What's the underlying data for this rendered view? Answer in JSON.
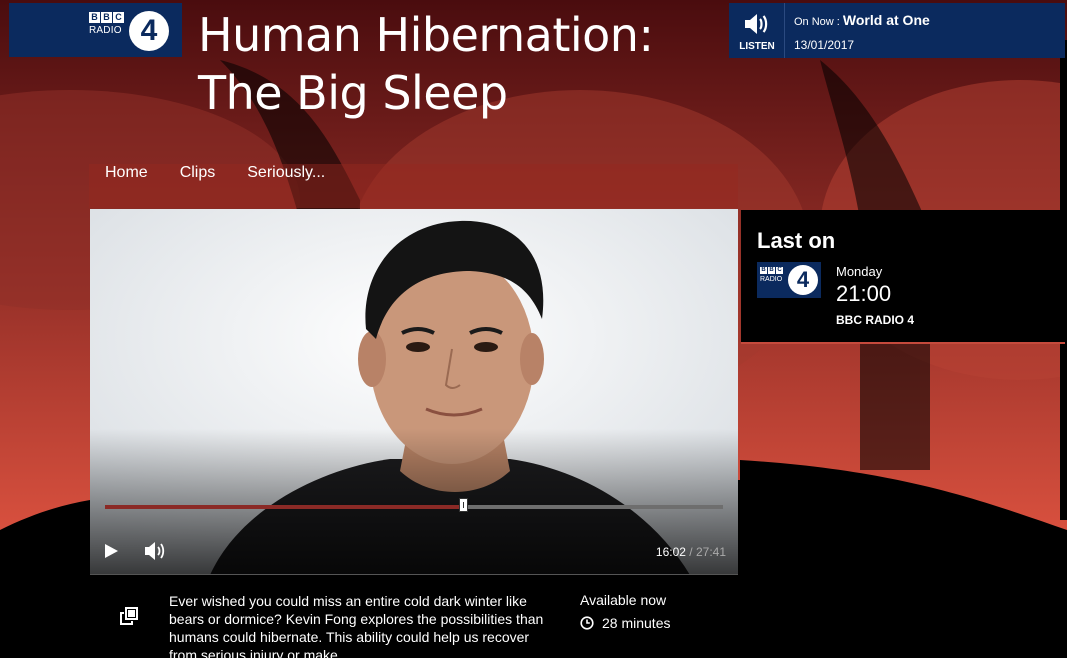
{
  "brand": {
    "bbc_letters": [
      "B",
      "B",
      "C"
    ],
    "radio_label": "RADIO",
    "station_number": "4"
  },
  "page_title_line1": "Human Hibernation:",
  "page_title_line2": "The Big Sleep",
  "listen": {
    "label": "LISTEN",
    "on_now_prefix": "On Now :",
    "on_now_programme": "World at One",
    "date": "13/01/2017"
  },
  "nav": [
    "Home",
    "Clips",
    "Seriously..."
  ],
  "player": {
    "current_time": "16:02",
    "separator": "/",
    "duration": "27:41",
    "progress_fraction": 0.579
  },
  "last_on": {
    "heading": "Last on",
    "day": "Monday",
    "time": "21:00",
    "station": "BBC RADIO 4"
  },
  "episode": {
    "description": "Ever wished you could miss an entire cold dark winter like bears or dormice? Kevin Fong explores the possibilities than humans could hibernate. This ability could help us recover from serious injury or make...",
    "availability": "Available now",
    "length": "28 minutes"
  },
  "colors": {
    "brand_blue": "#0b2a5e",
    "accent_red": "#c54a3c",
    "progress_red": "#8b2a26"
  }
}
